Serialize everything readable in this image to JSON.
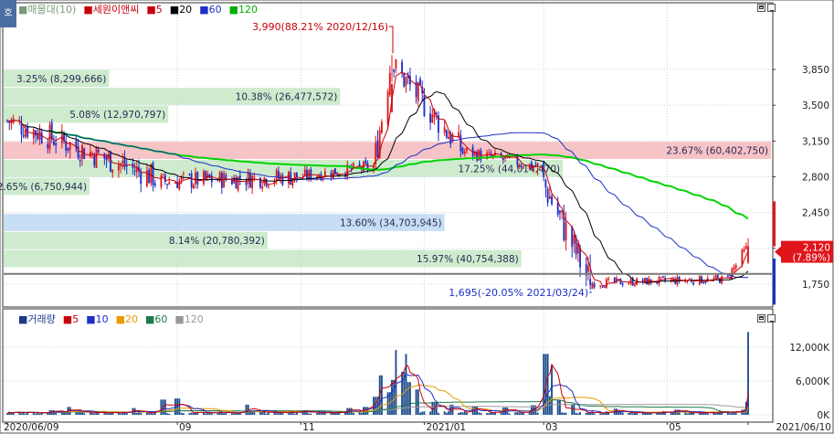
{
  "price_legend": {
    "volume_profile": "매물대(10)",
    "stock_name": "세원이앤씨",
    "ma": [
      "5",
      "20",
      "60",
      "120"
    ]
  },
  "volume_legend": {
    "title": "거래량",
    "ma": [
      "5",
      "10",
      "20",
      "60",
      "120"
    ]
  },
  "corner_icon": "호",
  "colors": {
    "up": "#e0151b",
    "down": "#1d2fc8",
    "ma5": "#c8000a",
    "ma20": "#000000",
    "ma60": "#1d2fc8",
    "ma120": "#00d400",
    "vol_ma5": "#c8000a",
    "vol_ma10": "#1d2fc8",
    "vol_ma20": "#e89a00",
    "vol_ma60": "#1e7a4a",
    "vol_ma120": "#999999",
    "profile_green": "#c5e8c5",
    "profile_red": "#f4b8bc",
    "profile_blue": "#bed8f2",
    "price_tag": "#e0151b"
  },
  "chart_data": [
    {
      "type": "candlestick",
      "title": "세원이앤씨",
      "x_ticks": [
        "2020/06/09",
        "09",
        "11",
        "2021/01",
        "03",
        "05",
        "2021/06/10"
      ],
      "y_ticks": [
        1750,
        2100,
        2450,
        2800,
        3150,
        3500,
        3850
      ],
      "ylim": [
        1550,
        4200
      ],
      "grid": true,
      "segments": [
        {
          "from": "2020/06/09",
          "to": "2020/08/20",
          "start": 3350,
          "end": 2800,
          "low": 2550,
          "high": 3450
        },
        {
          "from": "2020/08/20",
          "to": "2020/10/30",
          "start": 2750,
          "end": 2800,
          "low": 2550,
          "high": 3200
        },
        {
          "from": "2020/10/30",
          "to": "2020/12/07",
          "start": 2800,
          "end": 2900,
          "low": 2650,
          "high": 3100
        },
        {
          "from": "2020/12/07",
          "to": "2020/12/16",
          "start": 2900,
          "end": 3990,
          "low": 2850,
          "high": 3990
        },
        {
          "from": "2020/12/16",
          "to": "2021/01/20",
          "start": 3900,
          "end": 3050,
          "low": 2950,
          "high": 3950
        },
        {
          "from": "2021/01/20",
          "to": "2021/02/25",
          "start": 3050,
          "end": 2900,
          "low": 2800,
          "high": 3250
        },
        {
          "from": "2021/02/25",
          "to": "2021/03/24",
          "start": 2900,
          "end": 1760,
          "low": 1695,
          "high": 2950
        },
        {
          "from": "2021/03/24",
          "to": "2021/05/31",
          "start": 1760,
          "end": 1800,
          "low": 1650,
          "high": 1950
        },
        {
          "from": "2021/05/31",
          "to": "2021/06/10",
          "start": 1820,
          "end": 2120,
          "low": 1800,
          "high": 2200
        }
      ],
      "annotations": [
        {
          "text": "3,990(88.21% 2020/12/16)",
          "value": 3990,
          "date": "2020/12/16"
        },
        {
          "text": "1,695(-20.05% 2021/03/24)",
          "value": 1695,
          "date": "2021/03/24"
        }
      ],
      "current_price": {
        "value": 2120,
        "label": "2,120",
        "change": "(7.89%)"
      },
      "horizontal_line": 1850,
      "volume_profile": [
        {
          "label": "3.25% (8,299,666)",
          "price_from": 3674,
          "price_to": 3850,
          "length_pct": 3.25,
          "color": "green"
        },
        {
          "label": "10.38% (26,477,572)",
          "price_from": 3499,
          "price_to": 3674,
          "length_pct": 10.38,
          "color": "green"
        },
        {
          "label": "5.08% (12,970,797)",
          "price_from": 3323,
          "price_to": 3499,
          "length_pct": 5.08,
          "color": "green"
        },
        {
          "label": "23.67% (60,402,750)",
          "price_from": 2970,
          "price_to": 3147,
          "length_pct": 23.67,
          "color": "red"
        },
        {
          "label": "17.25% (44,014,470)",
          "price_from": 2794,
          "price_to": 2970,
          "length_pct": 17.25,
          "color": "green"
        },
        {
          "label": "2.65% (6,750,944)",
          "price_from": 2618,
          "price_to": 2794,
          "length_pct": 2.65,
          "color": "green"
        },
        {
          "label": "13.60% (34,703,945)",
          "price_from": 2265,
          "price_to": 2441,
          "length_pct": 13.6,
          "color": "blue"
        },
        {
          "label": "8.14% (20,780,392)",
          "price_from": 2089,
          "price_to": 2265,
          "length_pct": 8.14,
          "color": "green"
        },
        {
          "label": "15.97% (40,754,388)",
          "price_from": 1912,
          "price_to": 2089,
          "length_pct": 15.97,
          "color": "green"
        }
      ]
    },
    {
      "type": "bar",
      "title": "거래량",
      "y_ticks": [
        "0K",
        "6,000K",
        "12,000K"
      ],
      "y_tick_values": [
        0,
        6000,
        12000
      ],
      "ylim": [
        0,
        16000
      ],
      "spikes": [
        {
          "date": "2020/07/01",
          "value": 800
        },
        {
          "date": "2020/07/10",
          "value": 1400
        },
        {
          "date": "2020/08/10",
          "value": 1200
        },
        {
          "date": "2020/08/25",
          "value": 2700
        },
        {
          "date": "2020/09/01",
          "value": 2900
        },
        {
          "date": "2020/10/05",
          "value": 1800
        },
        {
          "date": "2020/11/03",
          "value": 800
        },
        {
          "date": "2020/11/25",
          "value": 1200
        },
        {
          "date": "2020/12/03",
          "value": 1400
        },
        {
          "date": "2020/12/08",
          "value": 3200
        },
        {
          "date": "2020/12/10",
          "value": 7000
        },
        {
          "date": "2020/12/11",
          "value": 13200
        },
        {
          "date": "2020/12/14",
          "value": 4000
        },
        {
          "date": "2020/12/16",
          "value": 6200
        },
        {
          "date": "2020/12/17",
          "value": 11500
        },
        {
          "date": "2020/12/18",
          "value": 5000
        },
        {
          "date": "2020/12/21",
          "value": 7600
        },
        {
          "date": "2020/12/22",
          "value": 10800
        },
        {
          "date": "2020/12/24",
          "value": 5800
        },
        {
          "date": "2020/12/28",
          "value": 4500
        },
        {
          "date": "2021/01/06",
          "value": 2300
        },
        {
          "date": "2021/01/15",
          "value": 1800
        },
        {
          "date": "2021/01/26",
          "value": 1500
        },
        {
          "date": "2021/02/10",
          "value": 1300
        },
        {
          "date": "2021/02/24",
          "value": 1700
        },
        {
          "date": "2021/03/02",
          "value": 10800
        },
        {
          "date": "2021/03/03",
          "value": 3300
        },
        {
          "date": "2021/03/04",
          "value": 8900
        },
        {
          "date": "2021/03/05",
          "value": 4800
        },
        {
          "date": "2021/03/08",
          "value": 2600
        },
        {
          "date": "2021/03/15",
          "value": 1900
        },
        {
          "date": "2021/04/05",
          "value": 1100
        },
        {
          "date": "2021/05/06",
          "value": 900
        },
        {
          "date": "2021/06/07",
          "value": 900
        },
        {
          "date": "2021/06/08",
          "value": 2300
        },
        {
          "date": "2021/06/10",
          "value": 14700
        }
      ]
    }
  ]
}
